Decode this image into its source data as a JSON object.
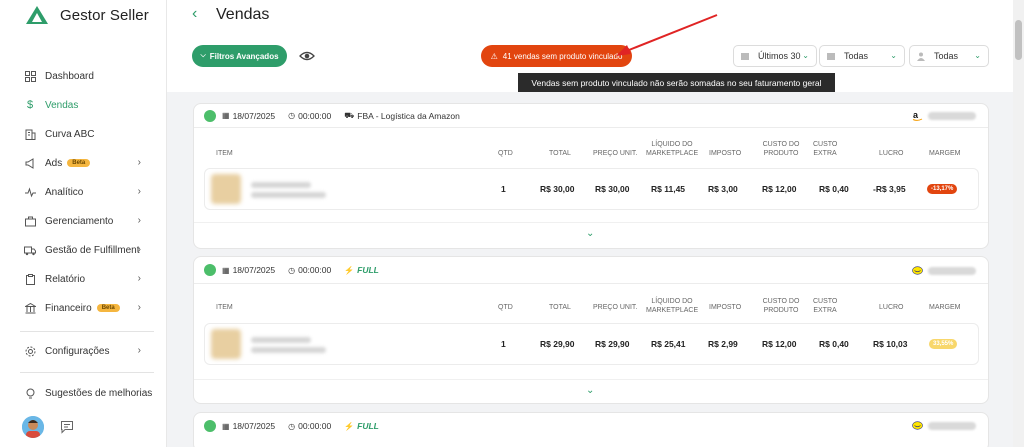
{
  "app": {
    "name": "Gestor Seller"
  },
  "sidebar": {
    "items": [
      {
        "label": "Dashboard",
        "icon": "dashboard-icon",
        "chevron": false
      },
      {
        "label": "Vendas",
        "icon": "dollar-icon",
        "chevron": false,
        "active": true
      },
      {
        "label": "Curva ABC",
        "icon": "building-icon",
        "chevron": false
      },
      {
        "label": "Ads",
        "icon": "megaphone-icon",
        "chevron": true,
        "badge": "Beta"
      },
      {
        "label": "Analítico",
        "icon": "pulse-icon",
        "chevron": true
      },
      {
        "label": "Gerenciamento",
        "icon": "briefcase-icon",
        "chevron": true
      },
      {
        "label": "Gestão de Fulfillment",
        "icon": "truck-icon",
        "chevron": true
      },
      {
        "label": "Relatório",
        "icon": "clipboard-icon",
        "chevron": true
      },
      {
        "label": "Financeiro",
        "icon": "bank-icon",
        "chevron": true,
        "badge": "Beta"
      },
      {
        "label": "Configurações",
        "icon": "gear-icon",
        "chevron": true
      },
      {
        "label": "Sugestões de melhorias",
        "icon": "lightbulb-icon",
        "chevron": false
      }
    ]
  },
  "header": {
    "title": "Vendas",
    "filters_button": "Filtros Avançados",
    "alert_button": "41 vendas sem produto vinculado",
    "tooltip": "Vendas sem produto vinculado não serão somadas no seu faturamento geral",
    "selects": [
      "Últimos 30",
      "Todas",
      "Todas"
    ]
  },
  "colors": {
    "accent": "#2e9d6a",
    "alert": "#e2450f",
    "badge_negative": "#e2450f",
    "badge_positive": "#f8d76b"
  },
  "columns": [
    "ITEM",
    "QTD",
    "TOTAL",
    "PREÇO UNIT.",
    "LÍQUIDO DO MARKETPLACE",
    "IMPOSTO",
    "CUSTO DO PRODUTO",
    "CUSTO EXTRA",
    "LUCRO",
    "MARGEM"
  ],
  "orders": [
    {
      "date": "18/07/2025",
      "time": "00:00:00",
      "shipping": "FBA - Logística da Amazon",
      "marketplace_icon": "amazon-icon",
      "row": {
        "qtd": "1",
        "total": "R$ 30,00",
        "preco_unit": "R$ 30,00",
        "liquido": "R$ 11,45",
        "imposto": "R$ 3,00",
        "custo_produto": "R$ 12,00",
        "custo_extra": "R$ 0,40",
        "lucro": "-R$ 3,95",
        "margem": "-13,17%"
      }
    },
    {
      "date": "18/07/2025",
      "time": "00:00:00",
      "shipping": "FULL",
      "marketplace_icon": "mercadolivre-icon",
      "row": {
        "qtd": "1",
        "total": "R$ 29,90",
        "preco_unit": "R$ 29,90",
        "liquido": "R$ 25,41",
        "imposto": "R$ 2,99",
        "custo_produto": "R$ 12,00",
        "custo_extra": "R$ 0,40",
        "lucro": "R$ 10,03",
        "margem": "33,55%"
      }
    },
    {
      "date": "18/07/2025",
      "time": "00:00:00",
      "shipping": "FULL",
      "marketplace_icon": "mercadolivre-icon"
    }
  ]
}
